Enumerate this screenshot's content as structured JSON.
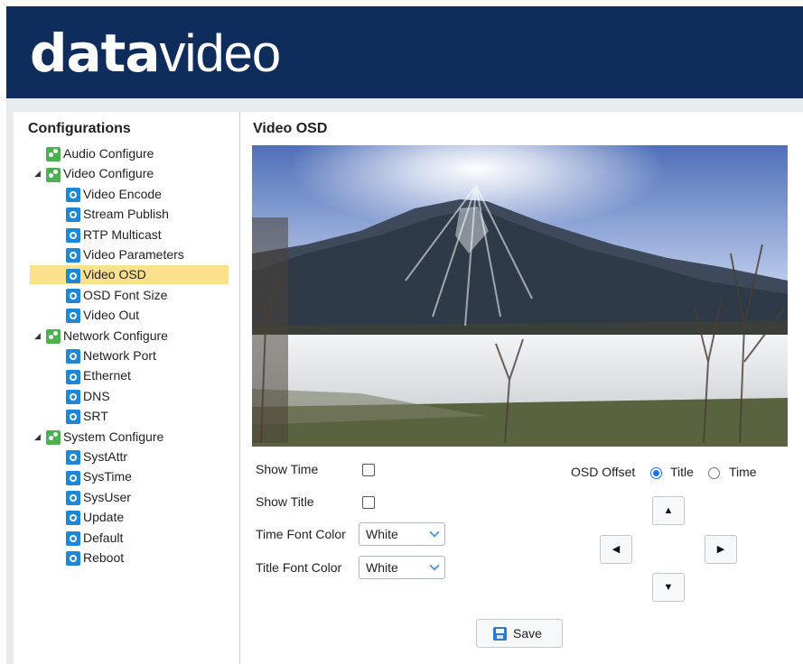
{
  "header": {
    "logo_bold": "data",
    "logo_light": "video"
  },
  "sidebar": {
    "title": "Configurations",
    "items": [
      {
        "label": "Audio Configure",
        "level": 0,
        "icon": "gear-group-icon"
      },
      {
        "label": "Video Configure",
        "level": 0,
        "icon": "gear-group-icon",
        "expanded": true
      },
      {
        "label": "Video Encode",
        "level": 1,
        "icon": "gear-icon"
      },
      {
        "label": "Stream Publish",
        "level": 1,
        "icon": "gear-icon"
      },
      {
        "label": "RTP Multicast",
        "level": 1,
        "icon": "gear-icon"
      },
      {
        "label": "Video Parameters",
        "level": 1,
        "icon": "gear-icon"
      },
      {
        "label": "Video OSD",
        "level": 1,
        "icon": "gear-icon",
        "selected": true
      },
      {
        "label": "OSD Font Size",
        "level": 1,
        "icon": "gear-icon"
      },
      {
        "label": "Video Out",
        "level": 1,
        "icon": "gear-icon"
      },
      {
        "label": "Network Configure",
        "level": 0,
        "icon": "gear-group-icon",
        "expanded": true
      },
      {
        "label": "Network Port",
        "level": 1,
        "icon": "gear-icon"
      },
      {
        "label": "Ethernet",
        "level": 1,
        "icon": "gear-icon"
      },
      {
        "label": "DNS",
        "level": 1,
        "icon": "gear-icon"
      },
      {
        "label": "SRT",
        "level": 1,
        "icon": "gear-icon"
      },
      {
        "label": "System Configure",
        "level": 0,
        "icon": "gear-group-icon",
        "expanded": true
      },
      {
        "label": "SystAttr",
        "level": 1,
        "icon": "gear-icon"
      },
      {
        "label": "SysTime",
        "level": 1,
        "icon": "gear-icon"
      },
      {
        "label": "SysUser",
        "level": 1,
        "icon": "gear-icon"
      },
      {
        "label": "Update",
        "level": 1,
        "icon": "gear-icon"
      },
      {
        "label": "Default",
        "level": 1,
        "icon": "gear-icon"
      },
      {
        "label": "Reboot",
        "level": 1,
        "icon": "gear-icon"
      }
    ]
  },
  "main": {
    "title": "Video OSD",
    "show_time_label": "Show Time",
    "show_time_checked": false,
    "show_title_label": "Show Title",
    "show_title_checked": false,
    "time_font_color_label": "Time Font Color",
    "time_font_color_value": "White",
    "title_font_color_label": "Title Font Color",
    "title_font_color_value": "White",
    "osd_offset_label": "OSD Offset",
    "offset_title_label": "Title",
    "offset_time_label": "Time",
    "offset_selected": "Title",
    "save_label": "Save"
  },
  "colors": {
    "header_bg": "#0f2d5c",
    "selected_item": "#fde08b",
    "gear_group_icon": "#4caf50",
    "gear_icon": "#1e88d6",
    "radio_accent": "#1a73e8"
  }
}
